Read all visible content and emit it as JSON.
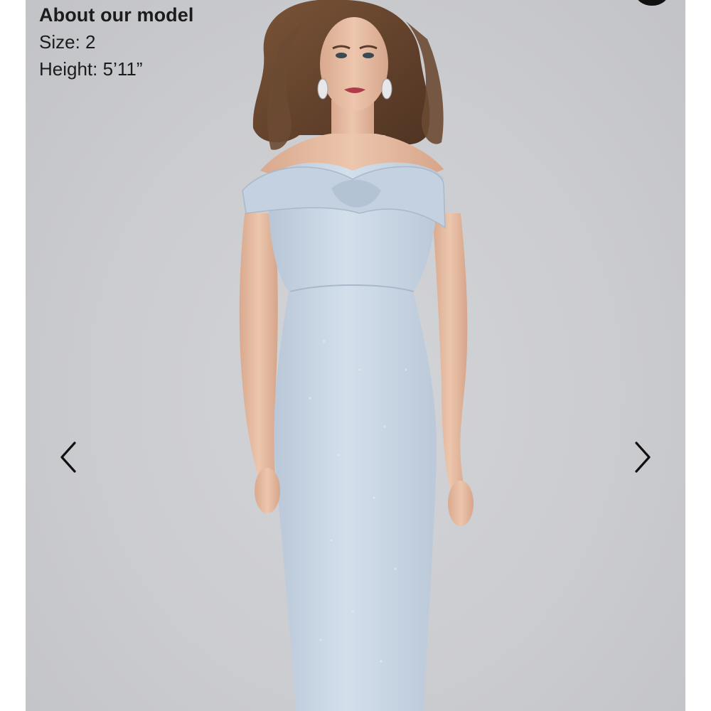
{
  "model_info": {
    "heading": "About our model",
    "size": "Size: 2",
    "height": "Height: 5’11”"
  },
  "gallery": {
    "image_subject": "model-in-light-blue-off-shoulder-gown",
    "prev_icon": "chevron-left-icon",
    "next_icon": "chevron-right-icon"
  },
  "colors": {
    "background": "#cbccd0",
    "dress": "#c9d6e4",
    "hair": "#6b4a33",
    "skin": "#e2b9a0",
    "text": "#1c1c1c",
    "icon": "#111111"
  }
}
